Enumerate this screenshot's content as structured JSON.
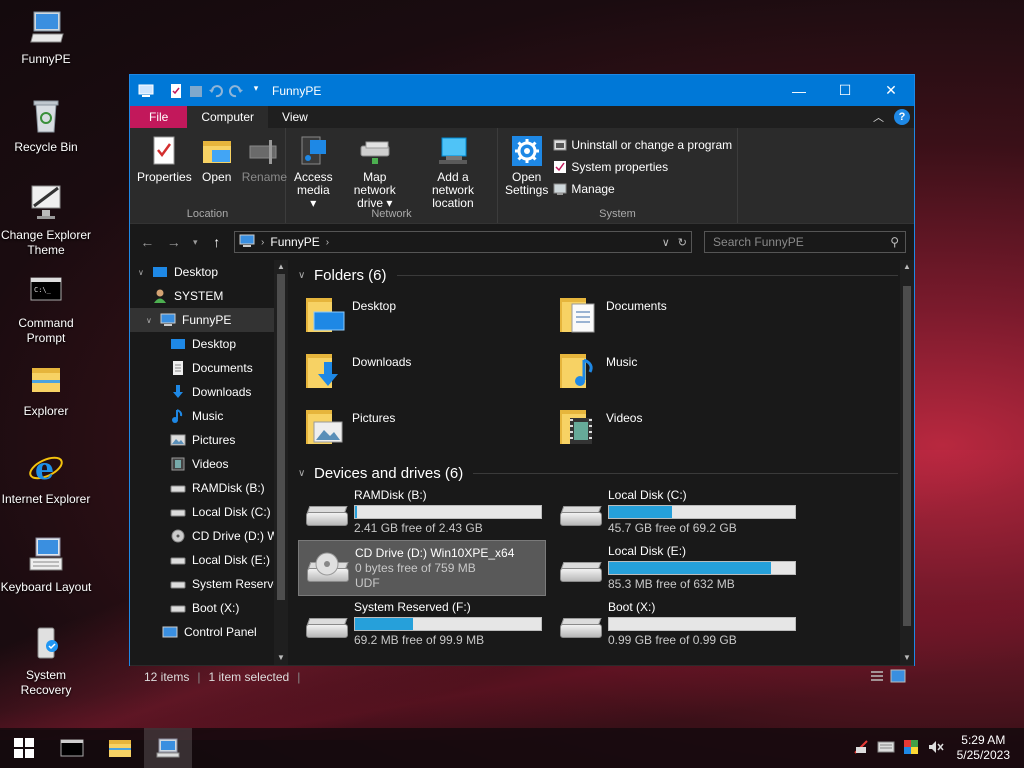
{
  "desktop": {
    "icons": [
      {
        "label": "FunnyPE"
      },
      {
        "label": "Recycle Bin"
      },
      {
        "label": "Change Explorer Theme"
      },
      {
        "label": "Command Prompt"
      },
      {
        "label": "Explorer"
      },
      {
        "label": "Internet Explorer"
      },
      {
        "label": "Keyboard Layout"
      },
      {
        "label": "System Recovery"
      }
    ]
  },
  "window": {
    "title": "FunnyPE",
    "tabs": {
      "file": "File",
      "computer": "Computer",
      "view": "View"
    },
    "help": "?",
    "ribbon": {
      "location": {
        "label": "Location",
        "properties": "Properties",
        "open": "Open",
        "rename": "Rename"
      },
      "network": {
        "label": "Network",
        "access_media_1": "Access",
        "access_media_2": "media ▾",
        "map_drive_1": "Map network",
        "map_drive_2": "drive ▾",
        "add_location_1": "Add a network",
        "add_location_2": "location"
      },
      "system": {
        "label": "System",
        "open_settings_1": "Open",
        "open_settings_2": "Settings",
        "uninstall": "Uninstall or change a program",
        "system_properties": "System properties",
        "manage": "Manage"
      }
    },
    "address": {
      "path": "FunnyPE",
      "search_placeholder": "Search FunnyPE"
    },
    "nav": [
      {
        "label": "Desktop"
      },
      {
        "label": "SYSTEM"
      },
      {
        "label": "FunnyPE"
      },
      {
        "label": "Desktop"
      },
      {
        "label": "Documents"
      },
      {
        "label": "Downloads"
      },
      {
        "label": "Music"
      },
      {
        "label": "Pictures"
      },
      {
        "label": "Videos"
      },
      {
        "label": "RAMDisk (B:)"
      },
      {
        "label": "Local Disk (C:)"
      },
      {
        "label": "CD Drive (D:) W"
      },
      {
        "label": "Local Disk (E:)"
      },
      {
        "label": "System Reserve"
      },
      {
        "label": "Boot (X:)"
      },
      {
        "label": "Control Panel"
      }
    ],
    "folders_header": "Folders (6)",
    "folders": [
      {
        "name": "Desktop"
      },
      {
        "name": "Documents"
      },
      {
        "name": "Downloads"
      },
      {
        "name": "Music"
      },
      {
        "name": "Pictures"
      },
      {
        "name": "Videos"
      }
    ],
    "drives_header": "Devices and drives (6)",
    "drives": [
      {
        "name": "RAMDisk (B:)",
        "detail": "2.41 GB free of 2.43 GB",
        "used_fraction": 0.01
      },
      {
        "name": "Local Disk (C:)",
        "detail": "45.7 GB free of 69.2 GB",
        "used_fraction": 0.34
      },
      {
        "name": "CD Drive (D:) Win10XPE_x64",
        "detail": "0 bytes free of 759 MB",
        "fs": "UDF"
      },
      {
        "name": "Local Disk (E:)",
        "detail": "85.3 MB free of 632 MB",
        "used_fraction": 0.87
      },
      {
        "name": "System Reserved (F:)",
        "detail": "69.2 MB free of 99.9 MB",
        "used_fraction": 0.31
      },
      {
        "name": "Boot (X:)",
        "detail": "0.99 GB free of 0.99 GB",
        "used_fraction": 0.0
      }
    ],
    "status": {
      "items": "12 items",
      "selected": "1 item selected"
    }
  },
  "taskbar": {
    "time": "5:29 AM",
    "date": "5/25/2023"
  },
  "colors": {
    "accent": "#0078d7",
    "file_tab": "#c2185b",
    "bar_fill": "#26a0da"
  }
}
